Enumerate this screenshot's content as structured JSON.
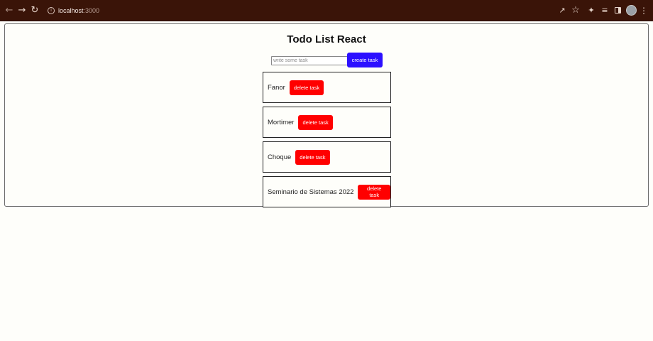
{
  "browser": {
    "url_host": "localhost",
    "url_port": ":3000",
    "icons": [
      "back-arrow-icon",
      "forward-arrow-icon",
      "reload-icon",
      "site-info-icon",
      "share-icon",
      "star-icon",
      "extensions-icon",
      "reading-list-icon",
      "side-panel-icon",
      "profile-avatar-icon",
      "more-menu-icon"
    ]
  },
  "app": {
    "title": "Todo List React",
    "input_placeholder": "write some task",
    "input_value": "",
    "create_label": "create task",
    "delete_label": "delete task",
    "tasks": [
      {
        "text": "Fanor"
      },
      {
        "text": "Mortimer"
      },
      {
        "text": "Choque"
      },
      {
        "text": "Seminario de Sistemas 2022"
      }
    ]
  },
  "colors": {
    "browser_bar": "#3a1408",
    "create_button": "#2c10ff",
    "delete_button": "#ff0000",
    "page_background": "#fefefa"
  }
}
